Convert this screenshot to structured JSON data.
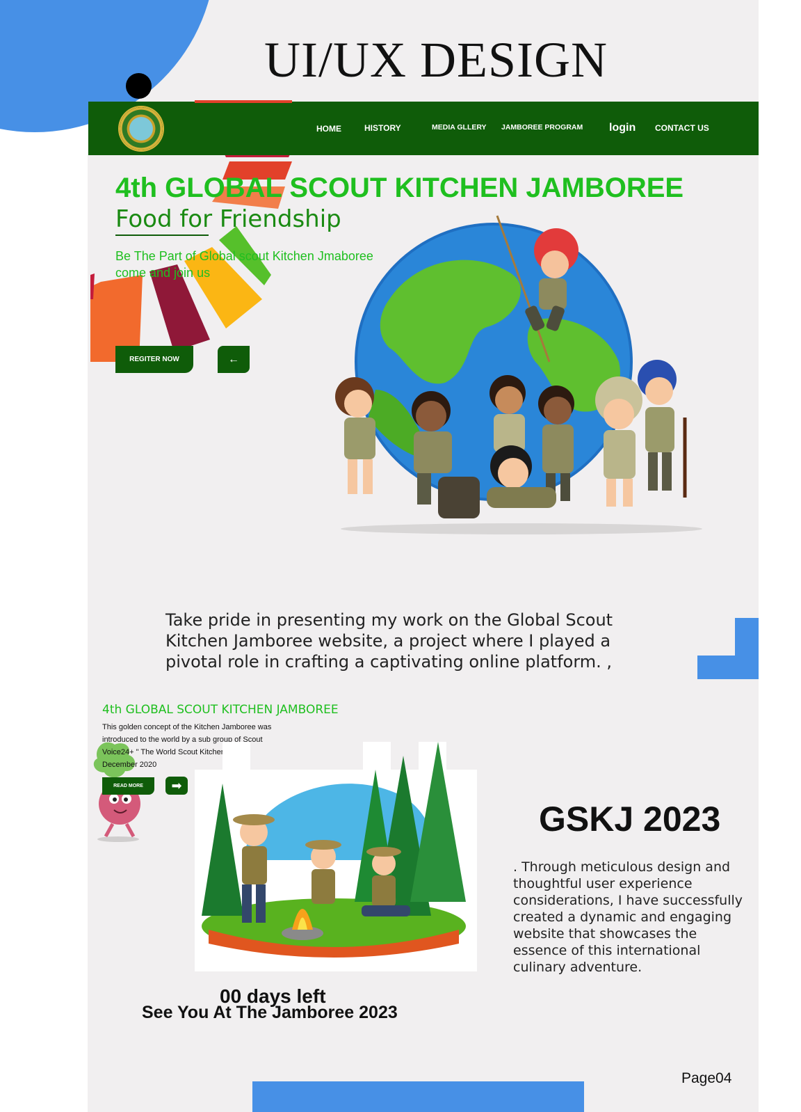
{
  "page": {
    "title": "UI/UX DESIGN",
    "page_number": "Page04"
  },
  "nav": {
    "items": [
      {
        "label": "HOME"
      },
      {
        "label": "HISTORY"
      },
      {
        "label": "MEDIA GLLERY"
      },
      {
        "label": "JAMBOREE PROGRAM"
      },
      {
        "label": "login"
      },
      {
        "label": "CONTACT US"
      }
    ]
  },
  "hero": {
    "title": "4th GLOBAL SCOUT KITCHEN JAMBOREE",
    "subtitle": "Food for Friendship",
    "desc_line1": "Be The Part of Global scout Kitchen Jmaboree",
    "desc_line2": "come and join us",
    "register_label": "REGITER NOW",
    "arrow_label": "←"
  },
  "intro": {
    "text": "Take pride in presenting my work on the Global Scout Kitchen Jamboree website, a project where I played a pivotal role in crafting a captivating online platform. ,"
  },
  "section": {
    "title": "4th GLOBAL SCOUT KITCHEN JAMBOREE",
    "text": "This golden concept of the Kitchen Jamboree was introduced to the world by a sub group of Scout Voice24+ \" The World Scout Kitchen\" - 26th December 2020",
    "read_more_label": "READ MORE",
    "arrow_label": "➡"
  },
  "gskj": {
    "title": "GSKJ 2023",
    "text": ". Through meticulous design and thoughtful user experience considerations, I have successfully created a dynamic and engaging website that showcases the essence of this international culinary adventure."
  },
  "countdown": {
    "days_text": "00 days left",
    "tagline": "See You At The Jamboree 2023"
  },
  "colors": {
    "accent_blue": "#4790e6",
    "nav_green": "#0f5c09",
    "title_green": "#1fbf1f"
  },
  "icons": [
    "logo-emblem",
    "arrow-left-icon",
    "arrow-right-icon"
  ]
}
